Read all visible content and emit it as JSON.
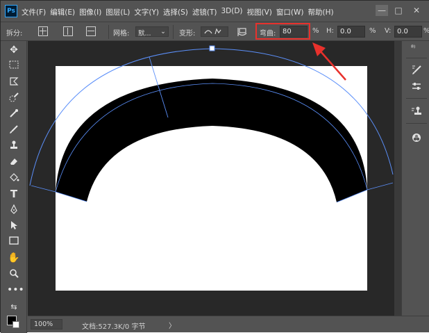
{
  "app": {
    "logo_text": "Ps"
  },
  "menu": {
    "items": [
      "文件(F)",
      "编辑(E)",
      "图像(I)",
      "图层(L)",
      "文字(Y)",
      "选择(S)",
      "滤镜(T)",
      "3D(D)",
      "视图(V)",
      "窗口(W)",
      "帮助(H)"
    ]
  },
  "window_controls": {
    "minimize": "—",
    "maximize": "□",
    "close": "✕"
  },
  "options_bar": {
    "split_label": "拆分:",
    "grid_label": "网格:",
    "grid_value": "默...",
    "warp_shape_label": "变形:",
    "warp_bend_label": "弯曲:",
    "warp_bend_value": "80",
    "percent_unit": "%",
    "h_label": "H:",
    "h_value": "0.0",
    "v_label": "V:",
    "v_value": "0.0"
  },
  "status_bar": {
    "zoom": "100%",
    "doc_info": "文档:527.3K/0 字节",
    "arrow": "〉"
  },
  "colors": {
    "annotation_red": "#e8312c",
    "warp_guide_blue": "#5b8ff9",
    "foreground": "#000000",
    "background": "#ffffff"
  },
  "icons": {
    "tools": [
      "move-icon",
      "marquee-icon",
      "lasso-icon",
      "quick-select-icon",
      "eyedropper-icon",
      "brush-icon",
      "stamp-icon",
      "eraser-icon",
      "paint-bucket-icon",
      "type-icon",
      "pen-icon",
      "path-select-icon",
      "rectangle-icon",
      "hand-icon",
      "zoom-icon",
      "more-tools-icon"
    ],
    "right_panel": [
      "history-icon",
      "brush-settings-icon",
      "adjustments-icon",
      "clone-source-icon",
      "layer-comps-icon"
    ]
  }
}
